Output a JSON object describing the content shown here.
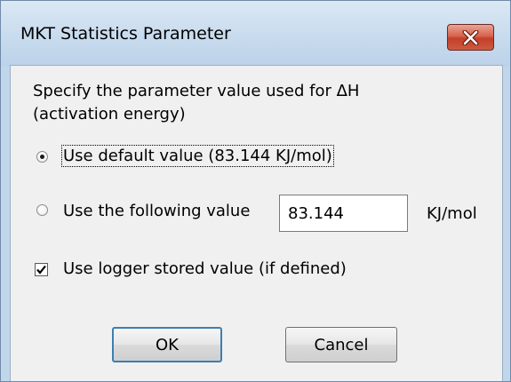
{
  "window": {
    "title": "MKT Statistics Parameter",
    "close_icon": "close-icon",
    "close_color": "#c74a33"
  },
  "dialog": {
    "description": "Specify the parameter value used for ΔH (activation energy)",
    "option_default": {
      "label": "Use default value (83.144 KJ/mol)",
      "selected": true
    },
    "option_custom": {
      "label": "Use the following value",
      "value": "83.144",
      "unit": "KJ/mol",
      "selected": false
    },
    "logger_checkbox": {
      "label": "Use logger stored value (if defined)",
      "checked": true
    },
    "ok_label": "OK",
    "cancel_label": "Cancel"
  }
}
